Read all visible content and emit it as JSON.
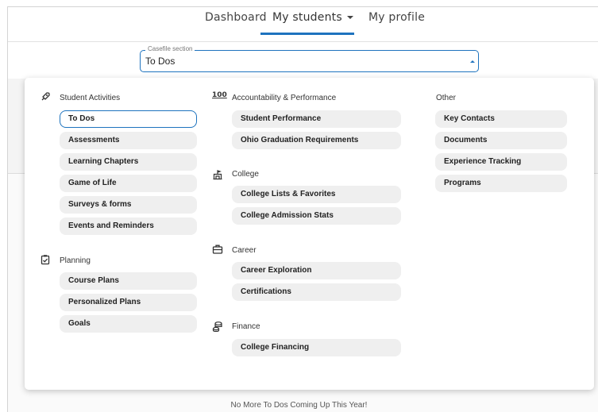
{
  "nav": {
    "dashboard": "Dashboard",
    "my_students": "My students",
    "my_profile": "My profile"
  },
  "casefile": {
    "label": "Casefile section",
    "value": "To Dos"
  },
  "menu": {
    "student_activities": {
      "title": "Student Activities",
      "icon": "rocket-icon",
      "items": [
        "To Dos",
        "Assessments",
        "Learning Chapters",
        "Game of Life",
        "Surveys & forms",
        "Events and Reminders"
      ]
    },
    "planning": {
      "title": "Planning",
      "icon": "clipboard-check-icon",
      "items": [
        "Course Plans",
        "Personalized Plans",
        "Goals"
      ]
    },
    "accountability": {
      "title": "Accountability & Performance",
      "icon": "score-100-icon",
      "icon_text": "100",
      "items": [
        "Student Performance",
        "Ohio Graduation Requirements"
      ]
    },
    "college": {
      "title": "College",
      "icon": "college-building-icon",
      "items": [
        "College Lists & Favorites",
        "College Admission Stats"
      ]
    },
    "career": {
      "title": "Career",
      "icon": "briefcase-icon",
      "items": [
        "Career Exploration",
        "Certifications"
      ]
    },
    "finance": {
      "title": "Finance",
      "icon": "coins-icon",
      "items": [
        "College Financing"
      ]
    },
    "other": {
      "title": "Other",
      "items": [
        "Key Contacts",
        "Documents",
        "Experience Tracking",
        "Programs"
      ]
    }
  },
  "footer": {
    "message": "No More To Dos Coming Up This Year!"
  },
  "colors": {
    "accent": "#1e73be",
    "chip_bg": "#efefef"
  }
}
